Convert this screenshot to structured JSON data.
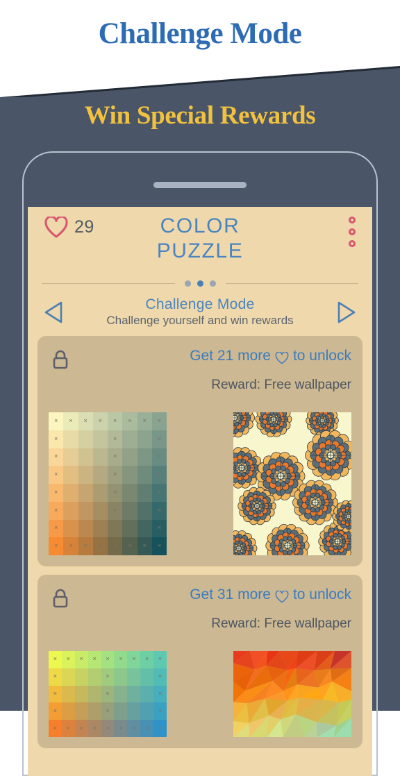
{
  "promo": {
    "title": "Challenge Mode",
    "subtitle": "Win Special Rewards",
    "title_color": "#2d6cb5",
    "subtitle_color": "#f2c23e",
    "background_color": "#4a5568"
  },
  "app": {
    "hearts_count": "29",
    "title_line1": "COLOR",
    "title_line2": "PUZZLE",
    "heart_icon": "heart-icon",
    "menu_icon": "kebab-menu-icon",
    "accent_color": "#4a85c0",
    "screen_background": "#efd8ab",
    "card_background": "#ccb893"
  },
  "pager": {
    "dots": [
      "inactive",
      "active",
      "inactive"
    ],
    "active_index": 1
  },
  "mode": {
    "prev_icon": "arrow-left-icon",
    "next_icon": "arrow-right-icon",
    "name": "Challenge Mode",
    "description": "Challenge yourself and win rewards"
  },
  "cards": [
    {
      "lock_icon": "lock-icon",
      "unlock_prefix": "Get 21 more",
      "unlock_heart_icon": "heart-outline-icon",
      "unlock_suffix": "to unlock",
      "reward": "Reward: Free wallpaper",
      "puzzle_thumb": {
        "name": "color-grid-thumbnail",
        "cols": 8,
        "rows": 8,
        "corner_colors": {
          "top_left": "#fbf6c0",
          "top_right": "#8aa391",
          "bottom_left": "#f68b33",
          "bottom_right": "#15525c"
        }
      },
      "wallpaper_thumb": {
        "name": "mandala-wallpaper-thumbnail",
        "style": "mandala",
        "background": "#f7f6cd",
        "colors": [
          "#f2b75c",
          "#e8792c",
          "#5a6f7a",
          "#2f3b44"
        ]
      }
    },
    {
      "lock_icon": "lock-icon",
      "unlock_prefix": "Get 31 more",
      "unlock_heart_icon": "heart-outline-icon",
      "unlock_suffix": "to unlock",
      "reward": "Reward: Free wallpaper",
      "puzzle_thumb": {
        "name": "color-grid-thumbnail",
        "cols": 9,
        "rows": 5,
        "corner_colors": {
          "top_left": "#ecf84f",
          "top_right": "#5cc9b0",
          "bottom_left": "#f57f2a",
          "bottom_right": "#2f93c9"
        }
      },
      "wallpaper_thumb": {
        "name": "polygon-wallpaper-thumbnail",
        "style": "low-poly",
        "colors": [
          "#ef3b16",
          "#f97b12",
          "#fbbd1f",
          "#f6f57a",
          "#7fd4c6",
          "#8e1f26"
        ]
      }
    }
  ]
}
